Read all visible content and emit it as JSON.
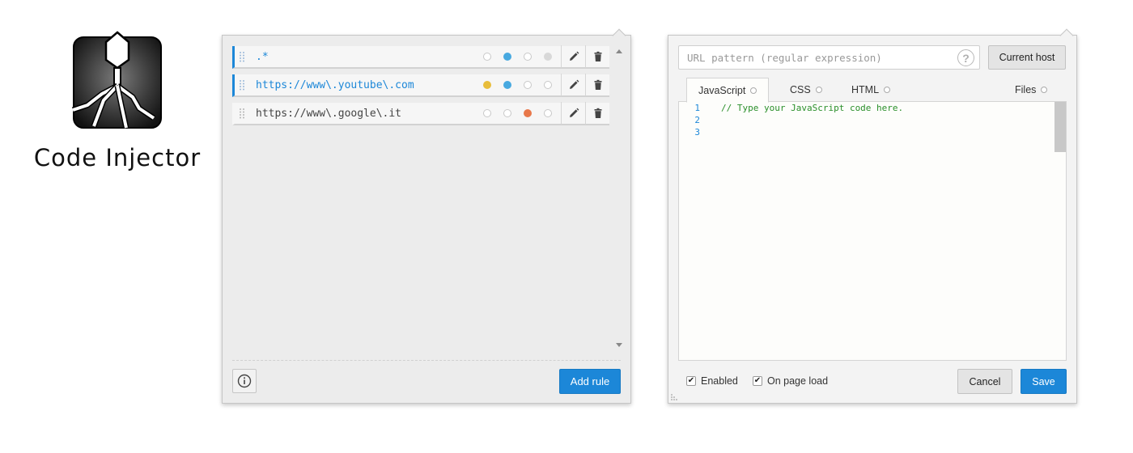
{
  "app": {
    "title": "Code Injector",
    "logo_icon": "virus-syringe-logo"
  },
  "rules_panel": {
    "rules": [
      {
        "pattern": ".*",
        "active": true,
        "indicators": [
          "empty",
          "#48a9e0",
          "empty",
          "#d8d8d8"
        ]
      },
      {
        "pattern": "https://www\\.youtube\\.com",
        "active": true,
        "indicators": [
          "#e8bd3a",
          "#48a9e0",
          "empty",
          "empty"
        ]
      },
      {
        "pattern": "https://www\\.google\\.it",
        "active": false,
        "indicators": [
          "empty",
          "empty",
          "#e8784a",
          "empty"
        ]
      }
    ],
    "rule_actions": {
      "edit_icon": "pencil-icon",
      "delete_icon": "trash-icon",
      "drag_icon": "drag-handle-icon"
    },
    "info_icon": "info-icon",
    "add_rule_label": "Add rule"
  },
  "editor_panel": {
    "url_placeholder": "URL pattern (regular expression)",
    "url_value": "",
    "help_label": "?",
    "current_host_label": "Current host",
    "tabs": [
      {
        "label": "JavaScript",
        "selected": true
      },
      {
        "label": "CSS",
        "selected": false
      },
      {
        "label": "HTML",
        "selected": false
      },
      {
        "label": "Files",
        "selected": false
      }
    ],
    "code_lines": [
      {
        "num": "1",
        "code": "// Type your JavaScript code here."
      },
      {
        "num": "2",
        "code": ""
      },
      {
        "num": "3",
        "code": ""
      }
    ],
    "enabled_label": "Enabled",
    "enabled_checked": true,
    "on_page_load_label": "On page load",
    "on_page_load_checked": true,
    "cancel_label": "Cancel",
    "save_label": "Save"
  },
  "colors": {
    "accent": "#1c87d8",
    "comment": "#2a8f2a",
    "panel_bg": "#ececec"
  }
}
